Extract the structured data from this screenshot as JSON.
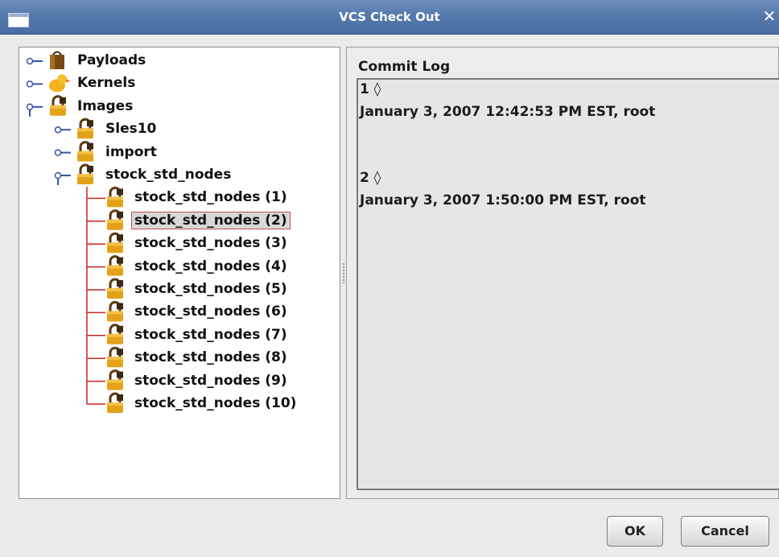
{
  "window": {
    "title": "VCS Check Out",
    "menu_icon": "window-menu-icon",
    "close_glyph": "✕"
  },
  "tree": {
    "nodes": [
      {
        "label": "Payloads",
        "icon": "bag-icon",
        "expanded": false
      },
      {
        "label": "Kernels",
        "icon": "duck-icon",
        "expanded": false
      },
      {
        "label": "Images",
        "icon": "lock-icon",
        "expanded": true,
        "children": [
          {
            "label": "Sles10",
            "icon": "lock-icon",
            "expanded": false
          },
          {
            "label": "import",
            "icon": "lock-icon",
            "expanded": false
          },
          {
            "label": "stock_std_nodes",
            "icon": "lock-icon",
            "expanded": true,
            "children": [
              {
                "label": "stock_std_nodes (1)"
              },
              {
                "label": "stock_std_nodes (2)",
                "selected": true
              },
              {
                "label": "stock_std_nodes (3)"
              },
              {
                "label": "stock_std_nodes (4)"
              },
              {
                "label": "stock_std_nodes (5)"
              },
              {
                "label": "stock_std_nodes (6)"
              },
              {
                "label": "stock_std_nodes (7)"
              },
              {
                "label": "stock_std_nodes (8)"
              },
              {
                "label": "stock_std_nodes (9)"
              },
              {
                "label": "stock_std_nodes (10)"
              }
            ]
          }
        ]
      }
    ]
  },
  "commit_log": {
    "title": "Commit Log",
    "lines": [
      "1 ◊",
      "January 3, 2007 12:42:53 PM EST, root",
      "",
      "",
      "2 ◊",
      "January 3, 2007 1:50:00 PM EST, root"
    ]
  },
  "buttons": {
    "ok": "OK",
    "cancel": "Cancel"
  },
  "colors": {
    "title_bar": "#5578ac",
    "tree_line_top": "#3355aa",
    "tree_line_leaf": "#cc2222",
    "selection_border": "#c0504d"
  }
}
